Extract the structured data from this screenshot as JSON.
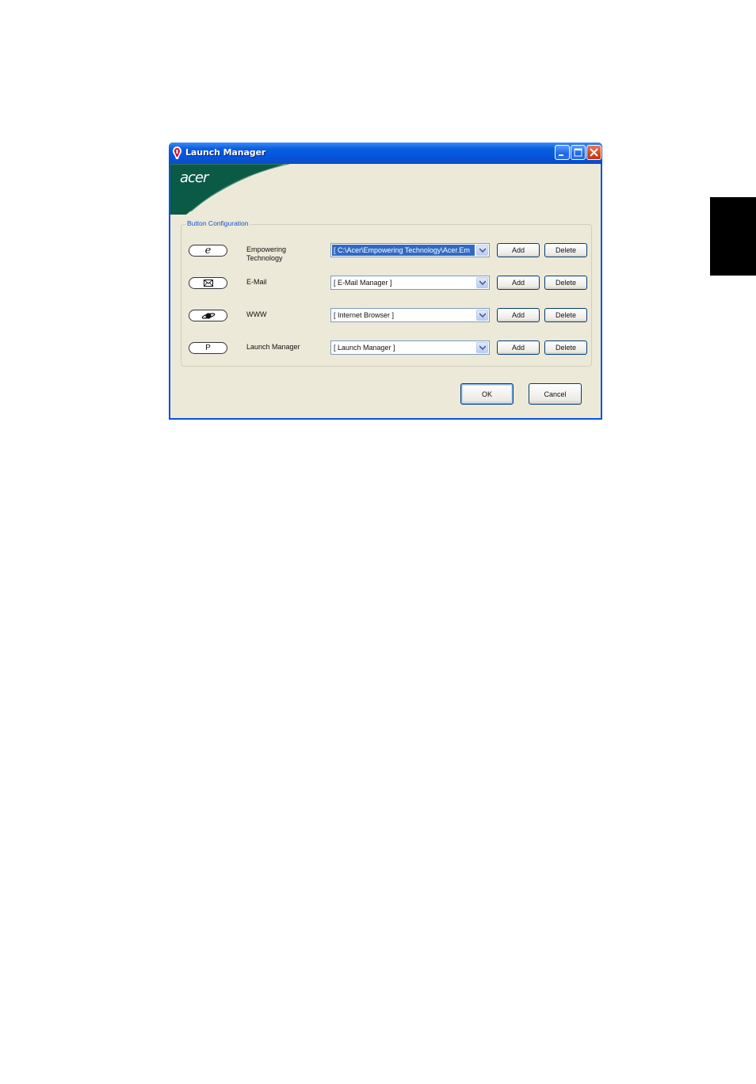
{
  "window": {
    "title": "Launch Manager",
    "brand": "acer",
    "brand_color": "#0b5a45"
  },
  "group": {
    "label": "Button Configuration"
  },
  "rows": [
    {
      "key_symbol": "e",
      "key_icon": "ie-e-icon",
      "label_line1": "Empowering",
      "label_line2": "Technology",
      "combo_value": "[ C:\\Acer\\Empowering Technology\\Acer.Em",
      "add_label": "Add",
      "delete_label": "Delete"
    },
    {
      "key_symbol": "✉",
      "key_icon": "mail-icon",
      "label_line1": "E-Mail",
      "combo_value": "[ E-Mail Manager ]",
      "add_label": "Add",
      "delete_label": "Delete"
    },
    {
      "key_symbol": "",
      "key_icon": "planet-icon",
      "label_line1": "WWW",
      "combo_value": "[ Internet Browser ]",
      "add_label": "Add",
      "delete_label": "Delete"
    },
    {
      "key_symbol": "P",
      "key_icon": "p-key-icon",
      "label_line1": "Launch Manager",
      "combo_value": "[ Launch Manager ]",
      "add_label": "Add",
      "delete_label": "Delete"
    }
  ],
  "footer": {
    "ok_label": "OK",
    "cancel_label": "Cancel"
  },
  "colors": {
    "titlebar": "#0553d9",
    "dialog_bg": "#ece9d8",
    "selection": "#316ac5",
    "side_tab": "#000000"
  }
}
